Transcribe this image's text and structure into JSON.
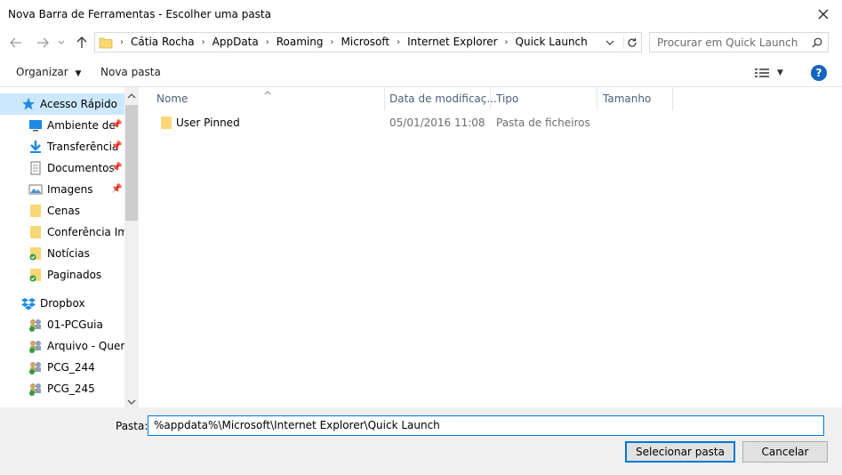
{
  "window": {
    "title": "Nova Barra de Ferramentas - Escolher uma pasta"
  },
  "address": {
    "crumbs": [
      "Cátia Rocha",
      "AppData",
      "Roaming",
      "Microsoft",
      "Internet Explorer",
      "Quick Launch"
    ]
  },
  "search": {
    "placeholder": "Procurar em Quick Launch"
  },
  "toolbar": {
    "organize_label": "Organizar",
    "new_folder_label": "Nova pasta"
  },
  "nav": {
    "quick_access": "Acesso Rápido",
    "items": [
      {
        "label": "Ambiente de",
        "icon": "desktop-icon",
        "pinned": true
      },
      {
        "label": "Transferência",
        "icon": "download-icon",
        "pinned": true
      },
      {
        "label": "Documentos",
        "icon": "document-icon",
        "pinned": true
      },
      {
        "label": "Imagens",
        "icon": "pictures-icon",
        "pinned": true
      },
      {
        "label": "Cenas",
        "icon": "folder-icon",
        "pinned": false
      },
      {
        "label": "Conferência Imp",
        "icon": "folder-icon",
        "pinned": false
      },
      {
        "label": "Notícias",
        "icon": "folder-synced-icon",
        "pinned": false
      },
      {
        "label": "Paginados",
        "icon": "folder-synced-icon",
        "pinned": false
      }
    ],
    "dropbox": "Dropbox",
    "dropbox_items": [
      "01-PCGuia",
      "Arquivo - Quem",
      "PCG_244",
      "PCG_245"
    ]
  },
  "columns": {
    "name": "Nome",
    "date": "Data de modificaç...",
    "type": "Tipo",
    "size": "Tamanho"
  },
  "files": [
    {
      "name": "User Pinned",
      "date": "05/01/2016 11:08",
      "type": "Pasta de ficheiros",
      "size": ""
    }
  ],
  "footer": {
    "folder_label": "Pasta:",
    "folder_value": "%appdata%\\Microsoft\\Internet Explorer\\Quick Launch",
    "select_label": "Selecionar pasta",
    "cancel_label": "Cancelar"
  },
  "colors": {
    "accent": "#0078d7",
    "folder": "#f8d775",
    "header_text": "#4c607a",
    "help": "#1565c0"
  }
}
